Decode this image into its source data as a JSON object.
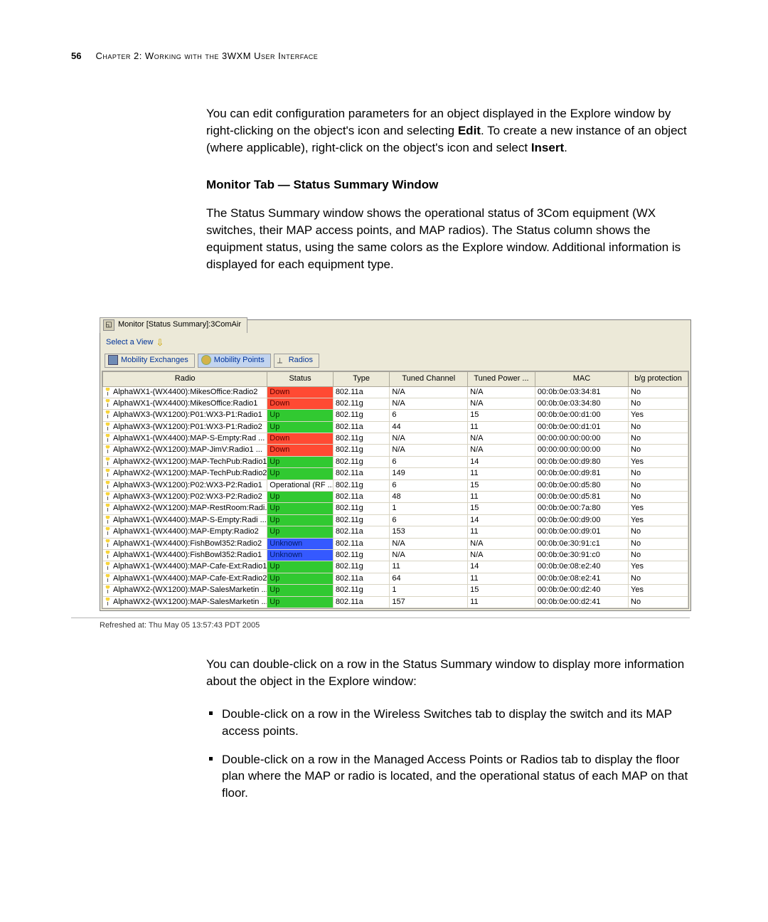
{
  "page_number": "56",
  "chapter_line": "Chapter 2: Working with the 3WXM User Interface",
  "para_intro_a": "You can edit configuration parameters for an object displayed in the Explore window by right-clicking on the object's icon and selecting ",
  "para_intro_edit": "Edit",
  "para_intro_b": ". To create a new instance of an object (where applicable), right-click on the object's icon and select ",
  "para_intro_insert": "Insert",
  "para_intro_c": ".",
  "subhead": "Monitor Tab — Status Summary Window",
  "para_status": "The Status Summary window shows the operational status of 3Com equipment (WX switches, their MAP access points, and MAP radios). The Status column shows the equipment status, using the same colors as the Explore window. Additional information is displayed for each equipment type.",
  "window_title": "Monitor [Status Summary]:3ComAir",
  "select_view": "Select a View",
  "tabs": {
    "mobility_exchanges": "Mobility Exchanges",
    "mobility_points": "Mobility Points",
    "radios": "Radios"
  },
  "columns": [
    "Radio",
    "Status",
    "Type",
    "Tuned Channel",
    "Tuned Power ...",
    "MAC",
    "b/g protection"
  ],
  "rows": [
    {
      "radio": "AlphaWX1-(WX4400):MikesOffice:Radio2",
      "status": "Down",
      "type": "802.11a",
      "chan": "N/A",
      "pow": "N/A",
      "mac": "00:0b:0e:03:34:81",
      "bg": "No"
    },
    {
      "radio": "AlphaWX1-(WX4400):MikesOffice:Radio1",
      "status": "Down",
      "type": "802.11g",
      "chan": "N/A",
      "pow": "N/A",
      "mac": "00:0b:0e:03:34:80",
      "bg": "No"
    },
    {
      "radio": "AlphaWX3-(WX1200):P01:WX3-P1:Radio1",
      "status": "Up",
      "type": "802.11g",
      "chan": "6",
      "pow": "15",
      "mac": "00:0b:0e:00:d1:00",
      "bg": "Yes"
    },
    {
      "radio": "AlphaWX3-(WX1200):P01:WX3-P1:Radio2",
      "status": "Up",
      "type": "802.11a",
      "chan": "44",
      "pow": "11",
      "mac": "00:0b:0e:00:d1:01",
      "bg": "No"
    },
    {
      "radio": "AlphaWX1-(WX4400):MAP-S-Empty:Rad ...",
      "status": "Down",
      "type": "802.11g",
      "chan": "N/A",
      "pow": "N/A",
      "mac": "00:00:00:00:00:00",
      "bg": "No"
    },
    {
      "radio": "AlphaWX2-(WX1200):MAP-JimV:Radio1 ...",
      "status": "Down",
      "type": "802.11g",
      "chan": "N/A",
      "pow": "N/A",
      "mac": "00:00:00:00:00:00",
      "bg": "No"
    },
    {
      "radio": "AlphaWX2-(WX1200):MAP-TechPub:Radio1",
      "status": "Up",
      "type": "802.11g",
      "chan": "6",
      "pow": "14",
      "mac": "00:0b:0e:00:d9:80",
      "bg": "Yes"
    },
    {
      "radio": "AlphaWX2-(WX1200):MAP-TechPub:Radio2",
      "status": "Up",
      "type": "802.11a",
      "chan": "149",
      "pow": "11",
      "mac": "00:0b:0e:00:d9:81",
      "bg": "No"
    },
    {
      "radio": "AlphaWX3-(WX1200):P02:WX3-P2:Radio1",
      "status": "Operational (RF ...",
      "type": "802.11g",
      "chan": "6",
      "pow": "15",
      "mac": "00:0b:0e:00:d5:80",
      "bg": "No"
    },
    {
      "radio": "AlphaWX3-(WX1200):P02:WX3-P2:Radio2",
      "status": "Up",
      "type": "802.11a",
      "chan": "48",
      "pow": "11",
      "mac": "00:0b:0e:00:d5:81",
      "bg": "No"
    },
    {
      "radio": "AlphaWX2-(WX1200):MAP-RestRoom:Radi...",
      "status": "Up",
      "type": "802.11g",
      "chan": "1",
      "pow": "15",
      "mac": "00:0b:0e:00:7a:80",
      "bg": "Yes"
    },
    {
      "radio": "AlphaWX1-(WX4400):MAP-S-Empty:Radi ...",
      "status": "Up",
      "type": "802.11g",
      "chan": "6",
      "pow": "14",
      "mac": "00:0b:0e:00:d9:00",
      "bg": "Yes"
    },
    {
      "radio": "AlphaWX1-(WX4400):MAP-Empty:Radio2",
      "status": "Up",
      "type": "802.11a",
      "chan": "153",
      "pow": "11",
      "mac": "00:0b:0e:00:d9:01",
      "bg": "No"
    },
    {
      "radio": "AlphaWX1-(WX4400):FishBowl352:Radio2",
      "status": "Unknown",
      "type": "802.11a",
      "chan": "N/A",
      "pow": "N/A",
      "mac": "00:0b:0e:30:91:c1",
      "bg": "No"
    },
    {
      "radio": "AlphaWX1-(WX4400):FishBowl352:Radio1",
      "status": "Unknown",
      "type": "802.11g",
      "chan": "N/A",
      "pow": "N/A",
      "mac": "00:0b:0e:30:91:c0",
      "bg": "No"
    },
    {
      "radio": "AlphaWX1-(WX4400):MAP-Cafe-Ext:Radio1",
      "status": "Up",
      "type": "802.11g",
      "chan": "11",
      "pow": "14",
      "mac": "00:0b:0e:08:e2:40",
      "bg": "Yes"
    },
    {
      "radio": "AlphaWX1-(WX4400):MAP-Cafe-Ext:Radio2",
      "status": "Up",
      "type": "802.11a",
      "chan": "64",
      "pow": "11",
      "mac": "00:0b:0e:08:e2:41",
      "bg": "No"
    },
    {
      "radio": "AlphaWX2-(WX1200):MAP-SalesMarketin ...",
      "status": "Up",
      "type": "802.11g",
      "chan": "1",
      "pow": "15",
      "mac": "00:0b:0e:00:d2:40",
      "bg": "Yes"
    },
    {
      "radio": "AlphaWX2-(WX1200):MAP-SalesMarketin ...",
      "status": "Up",
      "type": "802.11a",
      "chan": "157",
      "pow": "11",
      "mac": "00:0b:0e:00:d2:41",
      "bg": "No"
    }
  ],
  "refresh_line": "Refreshed at: Thu May 05 13:57:43 PDT 2005",
  "para_after": "You can double-click on a row in the Status Summary window to display more information about the object in the Explore window:",
  "bullets": [
    "Double-click on a row in the Wireless Switches tab to display the switch and its MAP access points.",
    "Double-click on a row in the Managed Access Points or Radios tab to display the floor plan where the MAP or radio is located, and the operational status of each MAP on that floor."
  ]
}
